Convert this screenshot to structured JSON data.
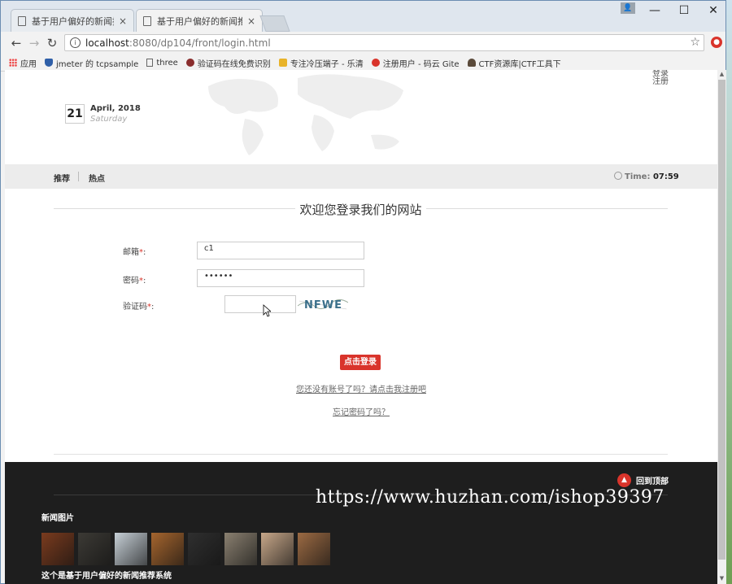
{
  "browser": {
    "tabs": [
      {
        "title": "基于用户偏好的新闻推荐",
        "close": "×"
      },
      {
        "title": "基于用户偏好的新闻推荐",
        "close": "×"
      }
    ],
    "window_controls": {
      "minimize": "—",
      "maximize": "☐",
      "close": "✕"
    },
    "url_host": "localhost",
    "url_path": ":8080/dp104/front/login.html",
    "bookmarks": [
      {
        "label": "应用",
        "icon": "apps-grid-icon"
      },
      {
        "label": "jmeter 的 tcpsample",
        "icon": "shield-icon"
      },
      {
        "label": "three",
        "icon": "page-icon"
      },
      {
        "label": "验证码在线免费识别",
        "icon": "bug-icon"
      },
      {
        "label": "专注冷压端子 - 乐清",
        "icon": "hand-icon"
      },
      {
        "label": "注册用户 - 码云 Gite",
        "icon": "gitee-icon"
      },
      {
        "label": "CTF资源库|CTF工具下",
        "icon": "person-icon"
      }
    ]
  },
  "header": {
    "login_link": "登录",
    "register_link": "注册",
    "date_day": "21",
    "date_month_year": "April, 2018",
    "date_weekday": "Saturday"
  },
  "nav": {
    "items": [
      "推荐",
      "热点"
    ],
    "time_label": "Time:",
    "time_value": "07:59"
  },
  "login": {
    "title": "欢迎您登录我们的网站",
    "email_label": "邮箱",
    "email_value": "c1",
    "password_label": "密码",
    "password_value": "••••••",
    "captcha_label": "验证码",
    "required_mark": "*",
    "colon": ":",
    "captcha_text": "NFWE",
    "submit_label": "点击登录",
    "register_prompt": "您还没有账号了吗？请点击我注册吧",
    "forgot_link": "忘记密码了吗？"
  },
  "footer": {
    "back_to_top": "回到顶部",
    "watermark": "https://www.huzhan.com/ishop39397",
    "news_pictures_title": "新闻图片",
    "caption": "这个是基于用户偏好的新闻推荐系统",
    "thumbnail_colors": [
      "#7a3b1e",
      "#3c3a35",
      "#c6cfd6",
      "#a5652e",
      "#2f2f2f",
      "#8a8070",
      "#c7a789",
      "#9b6a43"
    ]
  },
  "colors": {
    "accent": "#d9342b",
    "navbar_bg": "#ececec",
    "footer_bg": "#1e1e1e"
  }
}
